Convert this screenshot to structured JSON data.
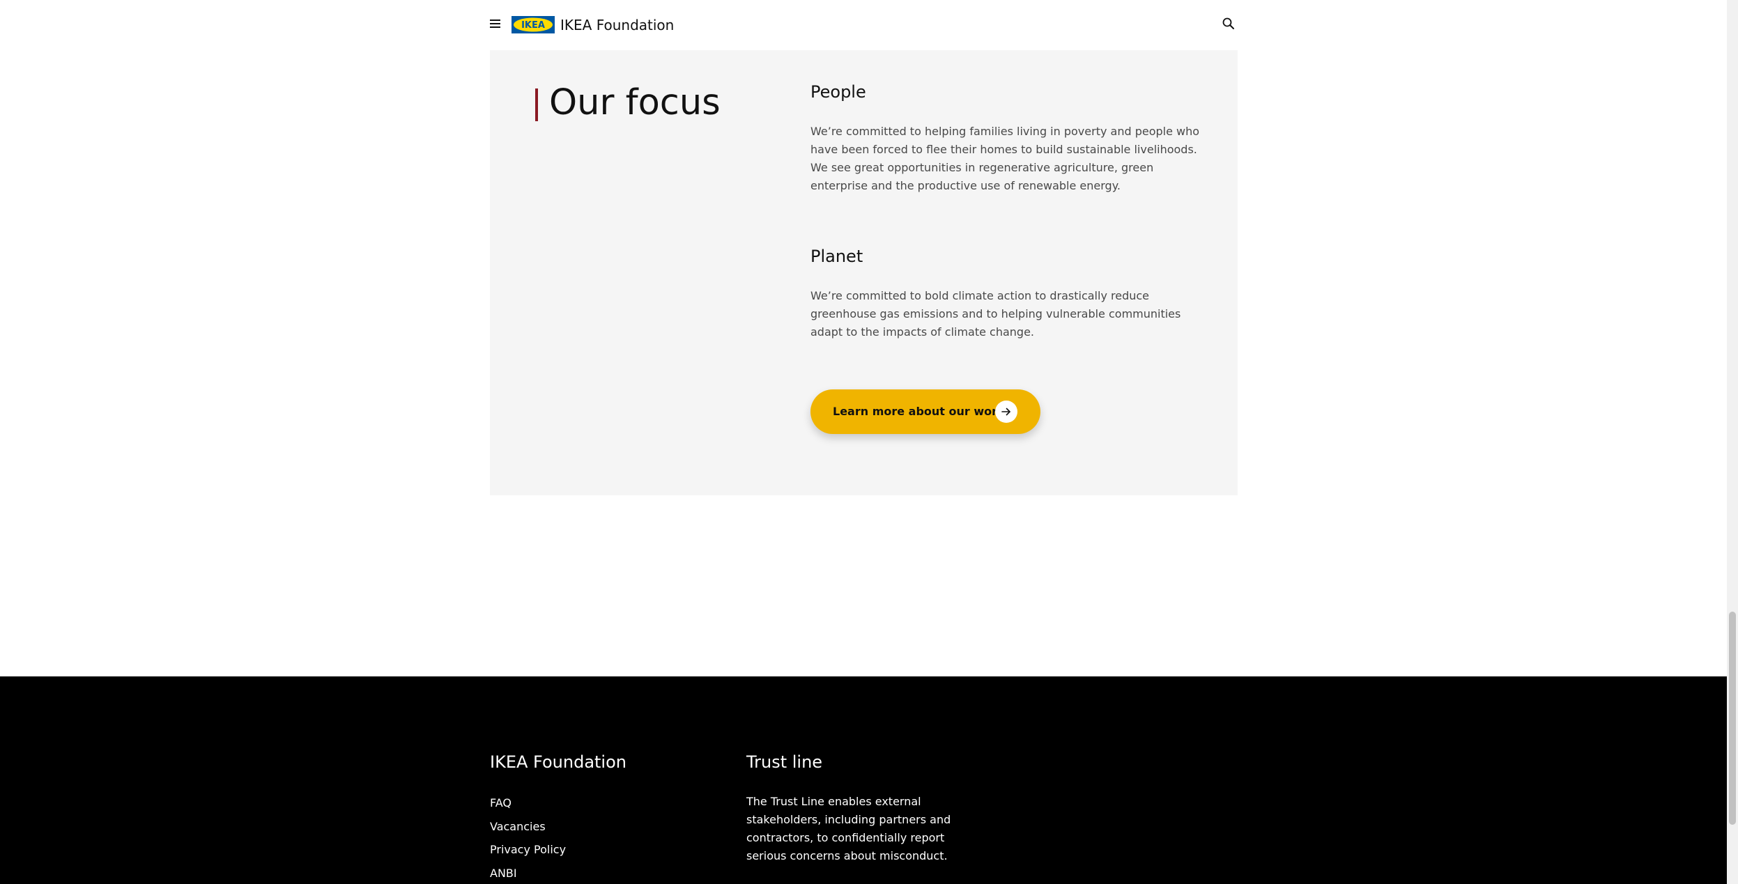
{
  "header": {
    "menu_icon": "hamburger-menu-icon",
    "logo_text": "IKEA",
    "brand_name": "IKEA Foundation",
    "search_icon": "search-icon"
  },
  "focus": {
    "title": "Our focus",
    "accent_color": "#8a1a23",
    "people": {
      "title": "People",
      "text": "We’re committed to helping families living in poverty and people who have been forced to flee their homes to build sustainable livelihoods. We see great opportunities in regenerative agriculture, green enterprise and the productive use of renewable energy."
    },
    "planet": {
      "title": "Planet",
      "text": "We’re committed to bold climate action to drastically reduce greenhouse gas emissions and to helping vulnerable communities adapt to the impacts of climate change."
    },
    "cta": {
      "label": "Learn more about our work",
      "icon": "arrow-right-icon",
      "color": "#f0b400"
    }
  },
  "footer": {
    "foundation": {
      "heading": "IKEA Foundation",
      "links": [
        "FAQ",
        "Vacancies",
        "Privacy Policy",
        "ANBI"
      ]
    },
    "trust": {
      "heading": "Trust line",
      "text": "The Trust Line enables external stakeholders, including partners and contractors, to confidentially report serious concerns about misconduct."
    }
  },
  "colors": {
    "logo_blue": "#0058a3",
    "logo_yellow": "#ffdb00",
    "panel_background": "#f5f5f5",
    "footer_background": "#000000"
  }
}
